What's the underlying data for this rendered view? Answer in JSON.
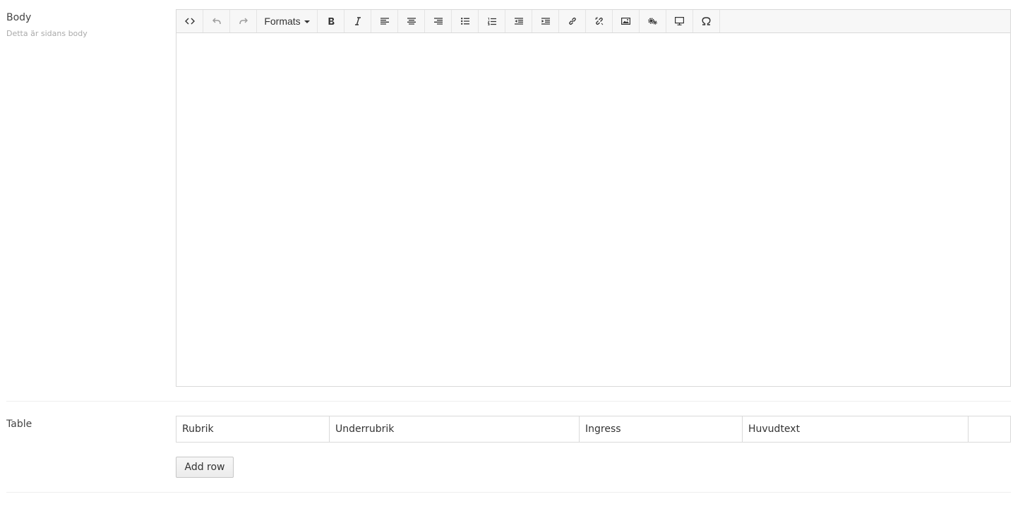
{
  "body_field": {
    "label": "Body",
    "help": "Detta är sidans body",
    "toolbar": {
      "formats_label": "Formats",
      "buttons": [
        {
          "name": "source-code",
          "icon": "code-icon"
        },
        {
          "name": "undo",
          "icon": "undo-icon"
        },
        {
          "name": "redo",
          "icon": "redo-icon"
        },
        {
          "name": "bold",
          "icon": "bold-icon"
        },
        {
          "name": "italic",
          "icon": "italic-icon"
        },
        {
          "name": "align-left",
          "icon": "align-left-icon"
        },
        {
          "name": "align-center",
          "icon": "align-center-icon"
        },
        {
          "name": "align-right",
          "icon": "align-right-icon"
        },
        {
          "name": "bullet-list",
          "icon": "bullet-list-icon"
        },
        {
          "name": "numbered-list",
          "icon": "numbered-list-icon"
        },
        {
          "name": "outdent",
          "icon": "outdent-icon"
        },
        {
          "name": "indent",
          "icon": "indent-icon"
        },
        {
          "name": "link",
          "icon": "link-icon"
        },
        {
          "name": "unlink",
          "icon": "unlink-icon"
        },
        {
          "name": "image",
          "icon": "image-icon"
        },
        {
          "name": "settings",
          "icon": "gears-icon"
        },
        {
          "name": "preview",
          "icon": "monitor-icon"
        },
        {
          "name": "special-character",
          "icon": "omega-icon"
        }
      ]
    },
    "content": ""
  },
  "table_field": {
    "label": "Table",
    "columns": [
      "Rubrik",
      "Underrubrik",
      "Ingress",
      "Huvudtext",
      ""
    ],
    "add_row_label": "Add row"
  }
}
